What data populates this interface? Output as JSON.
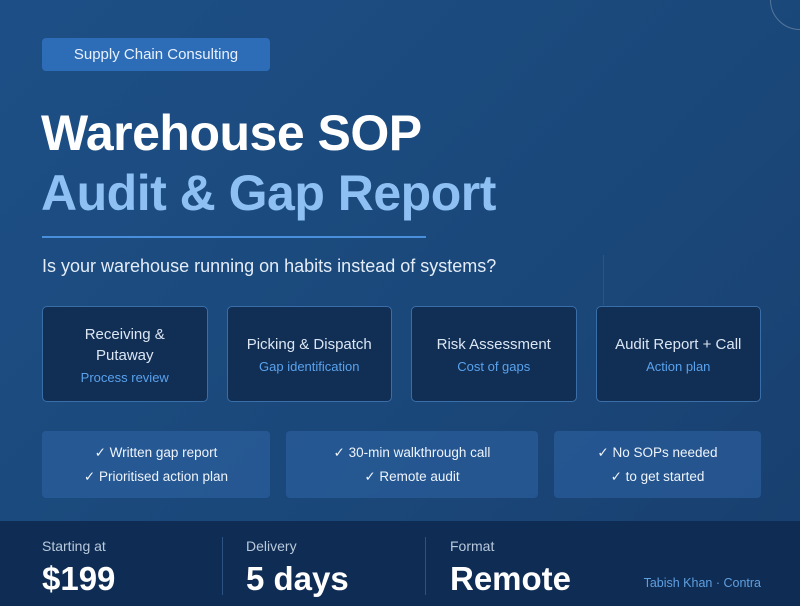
{
  "tag": "Supply Chain Consulting",
  "title": {
    "line1": "Warehouse SOP",
    "line2": "Audit & Gap Report"
  },
  "subtitle": "Is your warehouse running on habits instead of systems?",
  "cards": [
    {
      "title": "Receiving & Putaway",
      "sub": "Process review"
    },
    {
      "title": "Picking & Dispatch",
      "sub": "Gap identification"
    },
    {
      "title": "Risk Assessment",
      "sub": "Cost of gaps"
    },
    {
      "title": "Audit Report + Call",
      "sub": "Action plan"
    }
  ],
  "features": [
    {
      "line1": "✓ Written gap report",
      "line2": "✓ Prioritised action plan"
    },
    {
      "line1": "✓ 30-min walkthrough call",
      "line2": "✓ Remote audit"
    },
    {
      "line1": "✓ No SOPs needed",
      "line2": "✓ to get started"
    }
  ],
  "stats": [
    {
      "label": "Starting at",
      "value": "$199"
    },
    {
      "label": "Delivery",
      "value": "5 days"
    },
    {
      "label": "Format",
      "value": "Remote"
    }
  ],
  "credit": "Tabish Khan · Contra",
  "colors": {
    "background": "#1b4a80",
    "accent": "#8ec0f4",
    "tag": "#2d6db8",
    "card": "#112e55",
    "footer": "#0f2d54"
  }
}
